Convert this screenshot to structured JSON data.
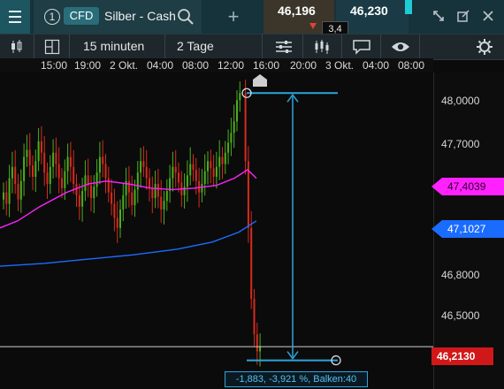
{
  "header": {
    "instrument_number": "1",
    "instrument_type": "CFD",
    "instrument_name": "Silber - Cash",
    "sell_price": "46,196",
    "buy_price": "46,230",
    "spread": "3,4"
  },
  "toolbar": {
    "interval": "15 minuten",
    "range": "2 Tage"
  },
  "time_axis": [
    "15:00",
    "19:00",
    "2 Okt.",
    "04:00",
    "08:00",
    "12:00",
    "16:00",
    "20:00",
    "3 Okt.",
    "04:00",
    "08:00"
  ],
  "price_axis": [
    "48,0000",
    "47,7000",
    "46,8000",
    "46,5000"
  ],
  "tags": {
    "ma_short": "47,4039",
    "ma_long": "47,1027",
    "last": "46,2130"
  },
  "measure": {
    "text": "-1,883, -3,921 %, Balken:40"
  },
  "colors": {
    "ma_short": "#ff22ff",
    "ma_long": "#1a6cff",
    "last": "#d01818",
    "measure": "#2ea4dd",
    "up_candle": "#4caf1e",
    "down_candle": "#d62b1f"
  },
  "chart_data": {
    "type": "candlestick",
    "y_unit": "price",
    "ylim": [
      45.94,
      48.12
    ],
    "ma_short_last": 47.4039,
    "ma_long_last": 47.1027,
    "last_price": 46.213,
    "measure_start_price": 48.0,
    "measure_end_price": 46.117,
    "series": [
      {
        "name": "price",
        "closes": [
          47.3,
          47.22,
          47.4,
          47.48,
          47.36,
          47.25,
          47.38,
          47.55,
          47.6,
          47.49,
          47.41,
          47.52,
          47.66,
          47.58,
          47.44,
          47.36,
          47.48,
          47.58,
          47.5,
          47.4,
          47.33,
          47.45,
          47.55,
          47.48,
          47.36,
          47.28,
          47.2,
          47.31,
          47.42,
          47.35,
          47.26,
          47.34,
          47.44,
          47.55,
          47.5,
          47.4,
          47.3,
          47.22,
          47.12,
          47.05,
          47.18,
          47.28,
          47.38,
          47.3,
          47.21,
          47.32,
          47.44,
          47.52,
          47.48,
          47.4,
          47.33,
          47.26,
          47.36,
          47.27,
          47.18,
          47.24,
          47.31,
          47.4,
          47.48,
          47.44,
          47.37,
          47.28,
          47.34,
          47.42,
          47.5,
          47.46,
          47.38,
          47.3,
          47.36,
          47.45,
          47.52,
          47.47,
          47.41,
          47.48,
          47.55,
          47.5,
          47.58,
          47.65,
          47.72,
          47.8,
          47.95,
          48.0,
          47.52,
          47.05,
          46.55,
          46.3,
          46.18,
          46.213
        ]
      }
    ]
  }
}
